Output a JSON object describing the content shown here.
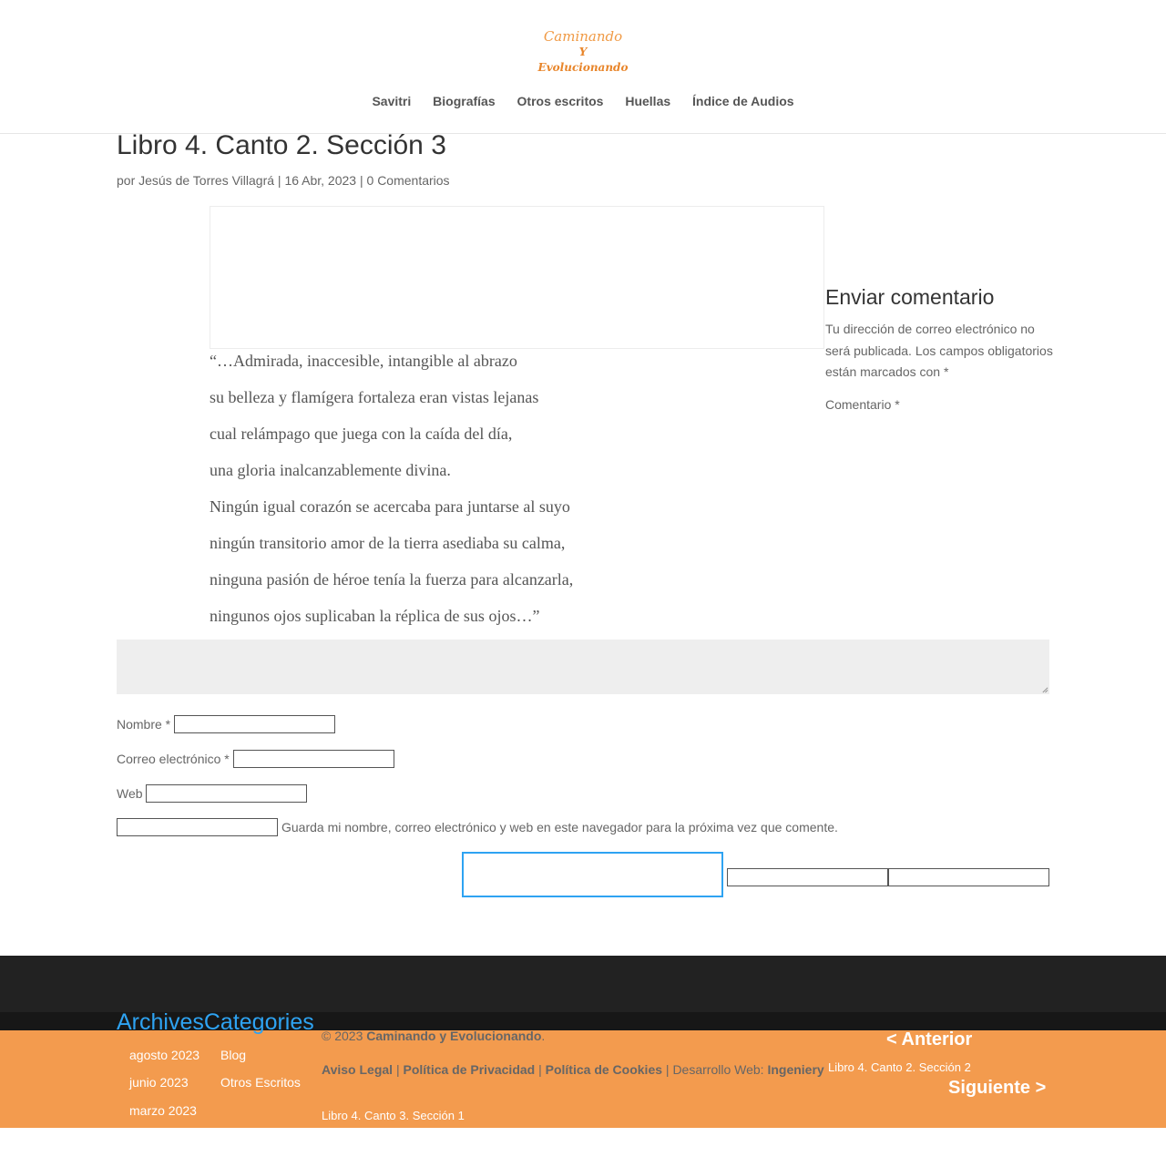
{
  "header": {
    "logo_line1": "Caminando",
    "logo_line2": "Y Evolucionando",
    "nav": [
      "Savitri",
      "Biografías",
      "Otros escritos",
      "Huellas",
      "Índice de Audios"
    ]
  },
  "post": {
    "title": "Libro 4. Canto 2. Sección 3",
    "meta_by": "por Jesús de Torres Villagrá",
    "meta_sep1": " | ",
    "meta_date": "16 Abr, 2023",
    "meta_sep2": " | ",
    "meta_comments": "0 Comentarios",
    "poem": [
      "“…Admirada, inaccesible, intangible al abrazo",
      "su belleza y flamígera fortaleza eran vistas lejanas",
      "cual relámpago que juega con la caída del día,",
      "una gloria inalcanzablemente divina.",
      "Ningún igual corazón se acercaba para juntarse al suyo",
      "ningún transitorio amor de la tierra asediaba su calma,",
      "ninguna pasión de héroe tenía la fuerza para alcanzarla,",
      "ningunos ojos suplicaban la réplica de sus ojos…”"
    ]
  },
  "comment_form": {
    "title": "Enviar comentario",
    "notes": "Tu dirección de correo electrónico no será publicada. Los campos obligatorios están marcados con *",
    "comment_label": "Comentario *",
    "name_label": "Nombre *",
    "email_label": "Correo electrónico *",
    "web_label": "Web",
    "cookies_label": "Guarda mi nombre, correo electrónico y web en este navegador para la próxima vez que comente."
  },
  "footer": {
    "widget_titles": "ArchivesCategories",
    "archives": [
      "agosto 2023",
      "junio 2023",
      "marzo 2023"
    ],
    "categories": [
      "Blog",
      "Otros Escritos"
    ],
    "copyright_prefix": "© 2023 ",
    "copyright_site": "Caminando y Evolucionando",
    "copyright_suffix": ".",
    "legal": "Aviso Legal",
    "sep": " | ",
    "privacy": "Política de Privacidad",
    "cookies": "Política de Cookies",
    "dev_label": "Desarrollo Web: ",
    "dev_name": "Ingeniery",
    "prev_label": "< Anterior",
    "prev_title": "Libro 4. Canto 2. Sección 2",
    "next_label": "Siguiente >",
    "next_title": "Libro 4. Canto 3. Sección 1"
  },
  "colors": {
    "accent": "#2ea3f2",
    "footer_orange": "#f39b4e",
    "footer_dark": "#222222",
    "logo_orange": "#f09a45"
  }
}
